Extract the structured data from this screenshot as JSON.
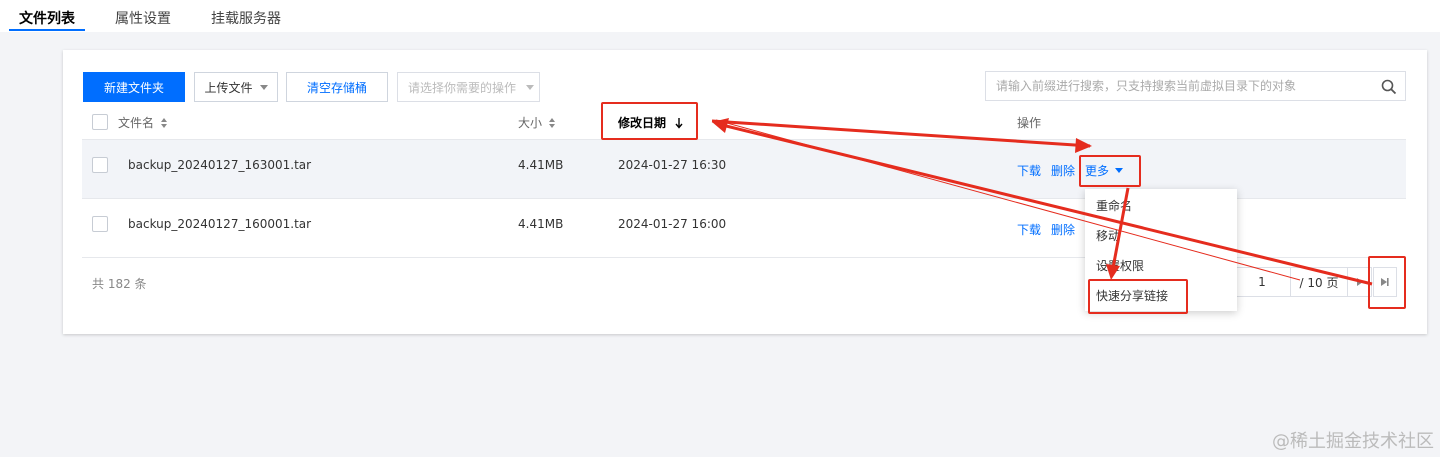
{
  "tabs": [
    {
      "label": "文件列表",
      "active": true
    },
    {
      "label": "属性设置",
      "active": false
    },
    {
      "label": "挂载服务器",
      "active": false
    }
  ],
  "toolbar": {
    "new_folder": "新建文件夹",
    "upload": "上传文件",
    "clear_bucket": "清空存储桶",
    "action_select_placeholder": "请选择你需要的操作"
  },
  "search": {
    "placeholder": "请输入前缀进行搜索，只支持搜索当前虚拟目录下的对象"
  },
  "table": {
    "columns": {
      "name": "文件名",
      "size": "大小",
      "modified": "修改日期",
      "actions": "操作"
    },
    "rows": [
      {
        "name": "backup_20240127_163001.tar",
        "size": "4.41MB",
        "modified": "2024-01-27 16:30"
      },
      {
        "name": "backup_20240127_160001.tar",
        "size": "4.41MB",
        "modified": "2024-01-27 16:00"
      }
    ],
    "row_actions": {
      "download": "下载",
      "delete": "删除",
      "more": "更多"
    }
  },
  "more_menu": {
    "items": [
      "重命名",
      "移动",
      "设置权限",
      "快速分享链接"
    ]
  },
  "footer": {
    "total": "共 182 条"
  },
  "pagination": {
    "current_page": "1",
    "total_pages": "/ 10 页"
  },
  "colors": {
    "primary": "#006eff",
    "annotation": "#e52c1e"
  },
  "watermark": "@稀土掘金技术社区"
}
